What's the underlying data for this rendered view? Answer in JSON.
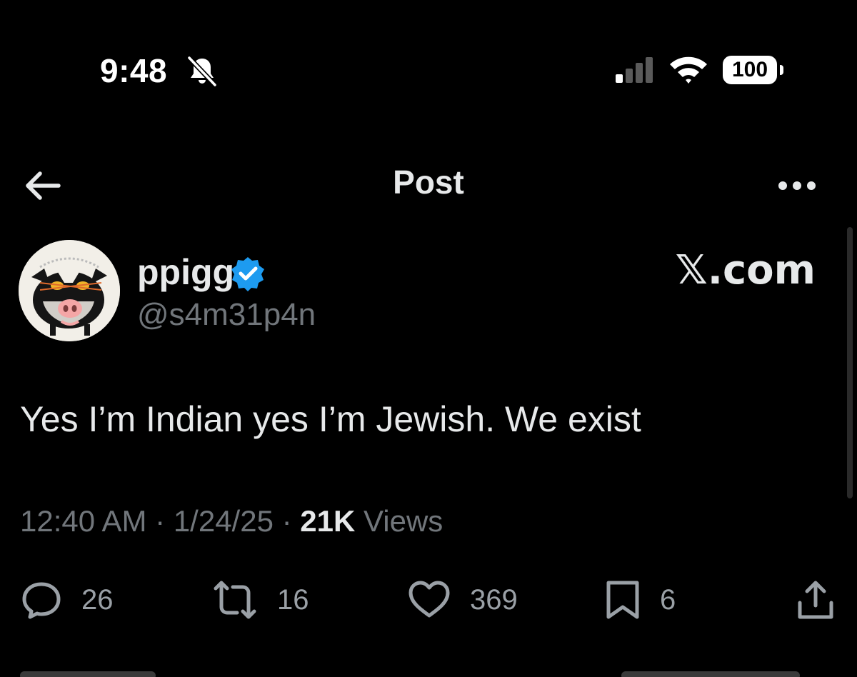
{
  "status_bar": {
    "time": "9:48",
    "battery": "100"
  },
  "nav": {
    "title": "Post"
  },
  "author": {
    "display_name": "ppigg",
    "handle": "@s4m31p4n",
    "verified": true
  },
  "watermark": "𝕏.com",
  "post": {
    "text": "Yes I’m Indian yes I’m Jewish. We exist",
    "time": "12:40 AM",
    "date": "1/24/25",
    "views_count": "21K",
    "views_label": "Views",
    "separator": "·"
  },
  "actions": {
    "replies": "26",
    "reposts": "16",
    "likes": "369",
    "bookmarks": "6"
  },
  "colors": {
    "background": "#000000",
    "text": "#e7e9ea",
    "secondary": "#71767b",
    "verified": "#1d9bf0"
  },
  "icons": [
    "bell-off-icon",
    "signal-icon",
    "wifi-icon",
    "battery-icon",
    "back-arrow-icon",
    "more-icon",
    "verified-badge-icon",
    "reply-icon",
    "repost-icon",
    "like-icon",
    "bookmark-icon",
    "share-icon"
  ]
}
